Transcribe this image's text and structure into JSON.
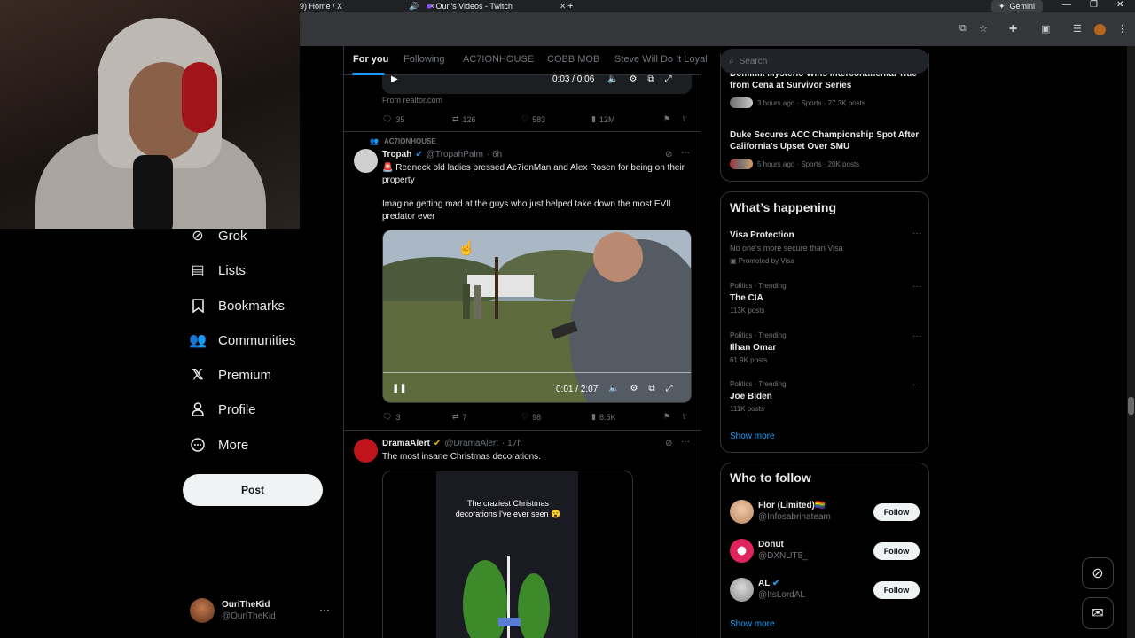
{
  "browser": {
    "tabs": [
      {
        "label": "9) Home / X"
      },
      {
        "label": "Ouri's Videos - Twitch"
      }
    ],
    "gemini_label": "Gemini"
  },
  "left_nav": {
    "items": [
      {
        "label": "Grok",
        "icon": "grok-icon"
      },
      {
        "label": "Lists",
        "icon": "lists-icon"
      },
      {
        "label": "Bookmarks",
        "icon": "bookmark-icon"
      },
      {
        "label": "Communities",
        "icon": "communities-icon"
      },
      {
        "label": "Premium",
        "icon": "x-logo-icon"
      },
      {
        "label": "Profile",
        "icon": "profile-icon"
      },
      {
        "label": "More",
        "icon": "more-icon"
      }
    ],
    "post_label": "Post",
    "account": {
      "name": "OuriTheKid",
      "handle": "@OuriTheKid"
    }
  },
  "feed": {
    "tabs": [
      "For you",
      "Following",
      "AC7IONHOUSE",
      "COBB MOB",
      "Steve Will Do It Loyal"
    ],
    "prev_post": {
      "video_time": "0:03 / 0:06",
      "source": "From realtor.com",
      "replies": "35",
      "reposts": "126",
      "likes": "583",
      "views": "12M"
    },
    "post1": {
      "community": "AC7IONHOUSE",
      "name": "Tropah",
      "handle": "@TropahPalm",
      "time": "· 6h",
      "text1": "🚨 Redneck old ladies pressed Ac7ionMan and Alex Rosen for being on their property",
      "text2": "Imagine getting mad at the guys who just helped take down the most EVIL predator ever",
      "video_time": "0:01 / 2:07",
      "replies": "3",
      "reposts": "7",
      "likes": "98",
      "views": "8.5K"
    },
    "post2": {
      "name": "DramaAlert",
      "handle": "@DramaAlert",
      "time": "· 17h",
      "text": "The most insane Christmas decorations.",
      "video_caption": "The craziest Christmas decorations I've ever seen 😮"
    }
  },
  "right": {
    "search_placeholder": "Search",
    "news": [
      {
        "title": "Dominik Mysterio Wins Intercontinental Title from Cena at Survivor Series",
        "meta": "3 hours ago · Sports · 27.3K posts"
      },
      {
        "title": "Duke Secures ACC Championship Spot After California's Upset Over SMU",
        "meta": "5 hours ago · Sports · 20K posts"
      }
    ],
    "whats_happening": {
      "title": "What’s happening",
      "promo": {
        "name": "Visa Protection",
        "desc": "No one's more secure than Visa",
        "promoted": "Promoted by Visa"
      },
      "trends": [
        {
          "meta": "Politics · Trending",
          "name": "The CIA",
          "count": "113K posts"
        },
        {
          "meta": "Politics · Trending",
          "name": "Ilhan Omar",
          "count": "61.9K posts"
        },
        {
          "meta": "Politics · Trending",
          "name": "Joe Biden",
          "count": "111K posts"
        }
      ],
      "show_more": "Show more"
    },
    "who_to_follow": {
      "title": "Who to follow",
      "users": [
        {
          "name": "Flor (Limited)🏳️‍🌈",
          "handle": "@Infosabrinateam",
          "button": "Follow"
        },
        {
          "name": "Donut",
          "handle": "@DXNUT5_",
          "button": "Follow"
        },
        {
          "name": "AL",
          "handle": "@ItsLordAL",
          "button": "Follow"
        }
      ],
      "show_more": "Show more"
    }
  },
  "colors": {
    "accent": "#1d9bf0",
    "background": "#000000",
    "border": "#2f3336",
    "muted": "#71767b"
  }
}
